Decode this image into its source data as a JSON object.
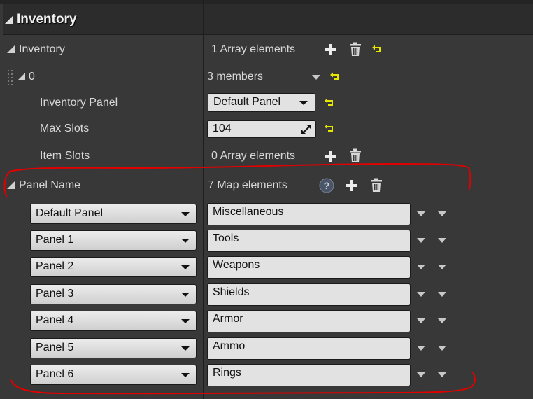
{
  "header": {
    "title": "Inventory"
  },
  "inventory": {
    "label": "Inventory",
    "value": "1 Array elements"
  },
  "element0": {
    "label": "0",
    "value": "3 members"
  },
  "inventory_panel": {
    "label": "Inventory Panel",
    "value": "Default Panel"
  },
  "max_slots": {
    "label": "Max Slots",
    "value": "104"
  },
  "item_slots": {
    "label": "Item Slots",
    "value": "0 Array elements"
  },
  "panel_name": {
    "label": "Panel Name",
    "value": "7 Map elements"
  },
  "map_entries": [
    {
      "key": "Default Panel",
      "value": "Miscellaneous"
    },
    {
      "key": "Panel 1",
      "value": "Tools"
    },
    {
      "key": "Panel 2",
      "value": "Weapons"
    },
    {
      "key": "Panel 3",
      "value": "Shields"
    },
    {
      "key": "Panel 4",
      "value": "Armor"
    },
    {
      "key": "Panel 5",
      "value": "Ammo"
    },
    {
      "key": "Panel 6",
      "value": "Rings"
    }
  ],
  "colors": {
    "background": "#383838",
    "header": "#2c2c2c",
    "reset_arrow": "#e6e600",
    "annotation": "#e00000"
  },
  "icons": [
    "plus-icon",
    "trash-icon",
    "reset-arrow-icon",
    "help-icon",
    "chevron-down-icon",
    "expand-arrow-icon",
    "grip-icon"
  ]
}
